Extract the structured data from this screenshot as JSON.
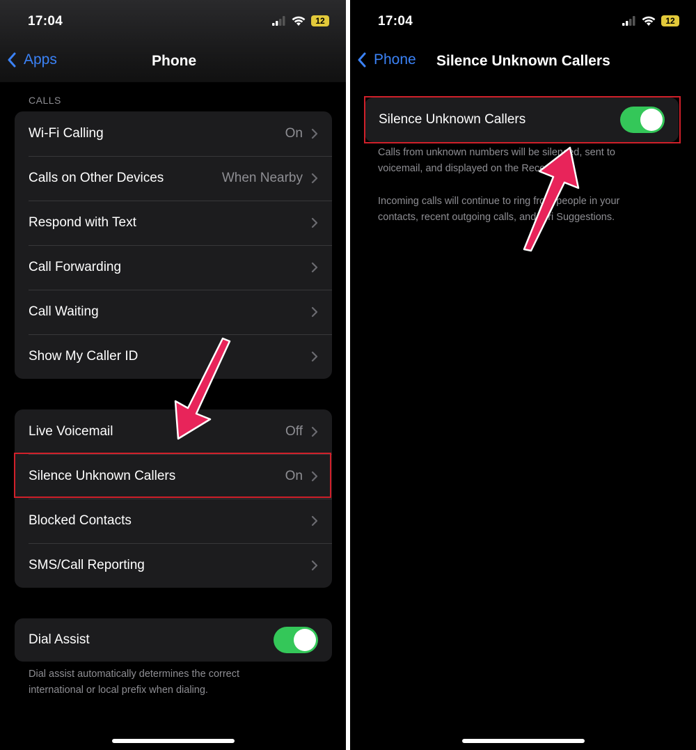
{
  "status": {
    "time": "17:04",
    "battery": "12"
  },
  "left": {
    "back_label": "Apps",
    "title": "Phone",
    "calls_header": "CALLS",
    "calls": [
      {
        "label": "Wi-Fi Calling",
        "value": "On"
      },
      {
        "label": "Calls on Other Devices",
        "value": "When Nearby"
      },
      {
        "label": "Respond with Text",
        "value": ""
      },
      {
        "label": "Call Forwarding",
        "value": ""
      },
      {
        "label": "Call Waiting",
        "value": ""
      },
      {
        "label": "Show My Caller ID",
        "value": ""
      }
    ],
    "group2": [
      {
        "label": "Live Voicemail",
        "value": "Off"
      },
      {
        "label": "Silence Unknown Callers",
        "value": "On"
      },
      {
        "label": "Blocked Contacts",
        "value": ""
      },
      {
        "label": "SMS/Call Reporting",
        "value": ""
      }
    ],
    "dial_assist": {
      "label": "Dial Assist",
      "enabled": true,
      "footer_line1": "Dial assist automatically determines the correct",
      "footer_line2": "international or local prefix when dialing."
    }
  },
  "right": {
    "back_label": "Phone",
    "title": "Silence Unknown Callers",
    "setting_label": "Silence Unknown Callers",
    "enabled": true,
    "desc1_line1": "Calls from unknown numbers will be silenced, sent to",
    "desc1_line2": "voicemail, and displayed on the Recents list.",
    "desc2_line1": "Incoming calls will continue to ring from people in your",
    "desc2_line2": "contacts, recent outgoing calls, and Siri Suggestions."
  },
  "colors": {
    "accent_blue": "#3b82f6",
    "toggle_green": "#34c759",
    "highlight_red": "#d0202a",
    "arrow_pink": "#e8245a"
  }
}
